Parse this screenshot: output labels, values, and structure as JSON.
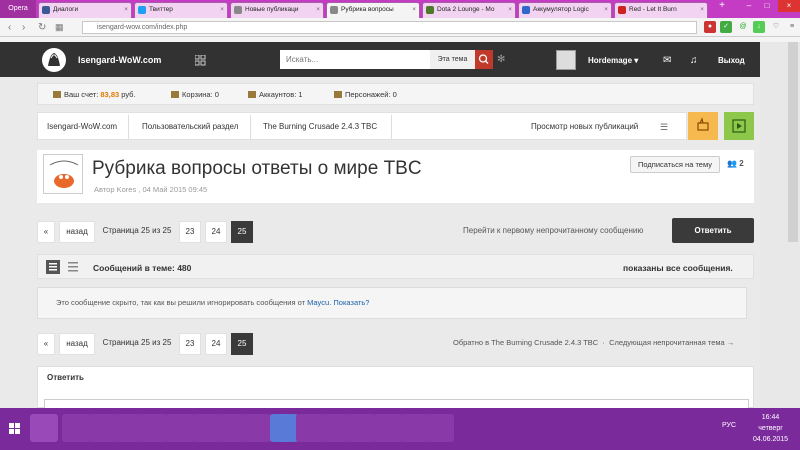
{
  "browser": {
    "menu_label": "Opera",
    "tabs": [
      {
        "label": "Диалоги",
        "color": "#3b5998"
      },
      {
        "label": "Твиттер",
        "color": "#1da1f2"
      },
      {
        "label": "Новые публикаци",
        "color": "#888888"
      },
      {
        "label": "Рубрика вопросы",
        "color": "#888888"
      },
      {
        "label": "Dota 2 Lounge - Mo",
        "color": "#4a7a2a"
      },
      {
        "label": "Аккумулятор Logic",
        "color": "#3366cc"
      },
      {
        "label": "Red - Let It Burn",
        "color": "#cc2222"
      }
    ],
    "url": "isengard-wow.com/index.php"
  },
  "header": {
    "site_name": "Isengard-WoW.com",
    "search_placeholder": "Искать...",
    "search_scope": "Эта тема",
    "username": "Hordemage",
    "logout": "Выход"
  },
  "stats": {
    "account_label": "Ваш счет:",
    "account_value": "83,83",
    "account_unit": "руб.",
    "cart": "Корзина: 0",
    "accounts": "Аккаунтов: 1",
    "characters": "Персонажей: 0"
  },
  "breadcrumb": {
    "items": [
      "Isengard-WoW.com",
      "Пользовательский раздел",
      "The Burning Crusade 2.4.3 TBC"
    ],
    "new_publications": "Просмотр новых публикаций"
  },
  "topic": {
    "title": "Рубрика вопросы ответы о мире TBC",
    "meta": "Автор Kores , 04 Май 2015 09:45",
    "subscribe": "Подписаться на тему",
    "followers": "2"
  },
  "pagination": {
    "first": "«",
    "prev": "назад",
    "info": "Страница 25 из 25",
    "pages": [
      "23",
      "24",
      "25"
    ],
    "current": "25"
  },
  "actions": {
    "first_unread": "Перейти к первому непрочитанному сообщению",
    "reply": "Ответить"
  },
  "posts": {
    "count": "Сообщений в теме: 480",
    "shown": "показаны все сообщения."
  },
  "ignored": {
    "text": "Это сообщение скрыто, так как вы решили игнорировать сообщения от",
    "user": "Maycu",
    "show": "Показать?"
  },
  "backlink": {
    "back": "Обратно в The Burning Crusade 2.4.3 TBC",
    "next": "Следующая непрочитанная тема →"
  },
  "reply_section": {
    "title": "Ответить"
  },
  "taskbar": {
    "time": "16:44",
    "day": "четверг",
    "date": "04.06.2015",
    "lang": "РУС"
  }
}
